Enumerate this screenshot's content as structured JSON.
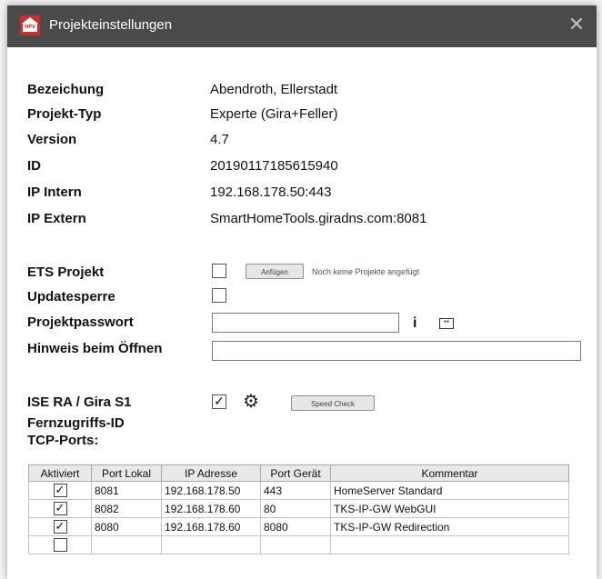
{
  "window": {
    "title": "Projekteinstellungen",
    "close_glyph": "✕",
    "icon_text": "HPV"
  },
  "info": {
    "bezeichnung_label": "Bezeichung",
    "bezeichnung_value": "Abendroth, Ellerstadt",
    "typ_label": "Projekt-Typ",
    "typ_value": "Experte (Gira+Feller)",
    "version_label": "Version",
    "version_value": "4.7",
    "id_label": "ID",
    "id_value": "20190117185615940",
    "ip_intern_label": "IP Intern",
    "ip_intern_value": "192.168.178.50:443",
    "ip_extern_label": "IP Extern",
    "ip_extern_value": "SmartHomeTools.giradns.com:8081"
  },
  "settings": {
    "ets_label": "ETS Projekt",
    "ets_checked": false,
    "append_button": "Anfügen",
    "no_projects": "Noch keine Projekte angefügt",
    "update_lock_label": "Updatesperre",
    "update_lock_checked": false,
    "password_label": "Projektpasswort",
    "password_value": "",
    "info_glyph": "i",
    "pw_toggle_glyph": "**",
    "hint_label": "Hinweis beim Öffnen",
    "hint_value": ""
  },
  "remote": {
    "ise_label": "ISE RA / Gira S1",
    "ise_checked": true,
    "check_glyph": "✓",
    "gear_glyph": "⚙",
    "speed_check_button": "Speed Check",
    "fernzugriff_label": "Fernzugriffs-ID",
    "tcp_ports_label": "TCP-Ports:"
  },
  "ports_table": {
    "headers": [
      "Aktiviert",
      "Port Lokal",
      "IP Adresse",
      "Port Gerät",
      "Kommentar"
    ],
    "rows": [
      {
        "active": true,
        "port_local": "8081",
        "ip": "192.168.178.50",
        "port_device": "443",
        "comment": "HomeServer Standard"
      },
      {
        "active": true,
        "port_local": "8082",
        "ip": "192.168.178.60",
        "port_device": "80",
        "comment": "TKS-IP-GW WebGUI"
      },
      {
        "active": true,
        "port_local": "8080",
        "ip": "192.168.178.60",
        "port_device": "8080",
        "comment": "TKS-IP-GW Redirection"
      },
      {
        "active": false,
        "port_local": "",
        "ip": "",
        "port_device": "",
        "comment": ""
      }
    ]
  }
}
